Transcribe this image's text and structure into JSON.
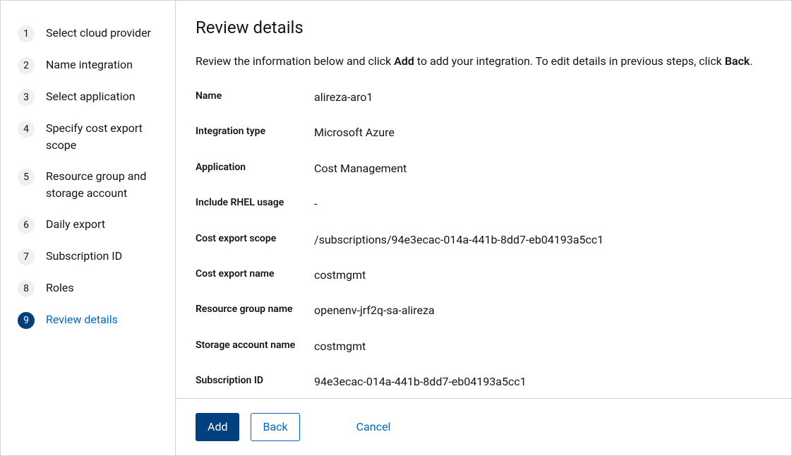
{
  "sidebar": {
    "steps": [
      {
        "num": "1",
        "label": "Select cloud provider"
      },
      {
        "num": "2",
        "label": "Name integration"
      },
      {
        "num": "3",
        "label": "Select application"
      },
      {
        "num": "4",
        "label": "Specify cost export scope"
      },
      {
        "num": "5",
        "label": "Resource group and storage account"
      },
      {
        "num": "6",
        "label": "Daily export"
      },
      {
        "num": "7",
        "label": "Subscription ID"
      },
      {
        "num": "8",
        "label": "Roles"
      },
      {
        "num": "9",
        "label": "Review details"
      }
    ]
  },
  "main": {
    "title": "Review details",
    "description_prefix": "Review the information below and click ",
    "description_bold1": "Add",
    "description_middle": " to add your integration. To edit details in previous steps, click ",
    "description_bold2": "Back",
    "description_suffix": ".",
    "details": [
      {
        "label": "Name",
        "value": "alireza-aro1"
      },
      {
        "label": "Integration type",
        "value": "Microsoft Azure"
      },
      {
        "label": "Application",
        "value": "Cost Management"
      },
      {
        "label": "Include RHEL usage",
        "value": "-"
      },
      {
        "label": "Cost export scope",
        "value": "/subscriptions/94e3ecac-014a-441b-8dd7-eb04193a5cc1"
      },
      {
        "label": "Cost export name",
        "value": "costmgmt"
      },
      {
        "label": "Resource group name",
        "value": "openenv-jrf2q-sa-alireza"
      },
      {
        "label": "Storage account name",
        "value": "costmgmt"
      },
      {
        "label": "Subscription ID",
        "value": "94e3ecac-014a-441b-8dd7-eb04193a5cc1"
      }
    ]
  },
  "footer": {
    "add": "Add",
    "back": "Back",
    "cancel": "Cancel"
  }
}
